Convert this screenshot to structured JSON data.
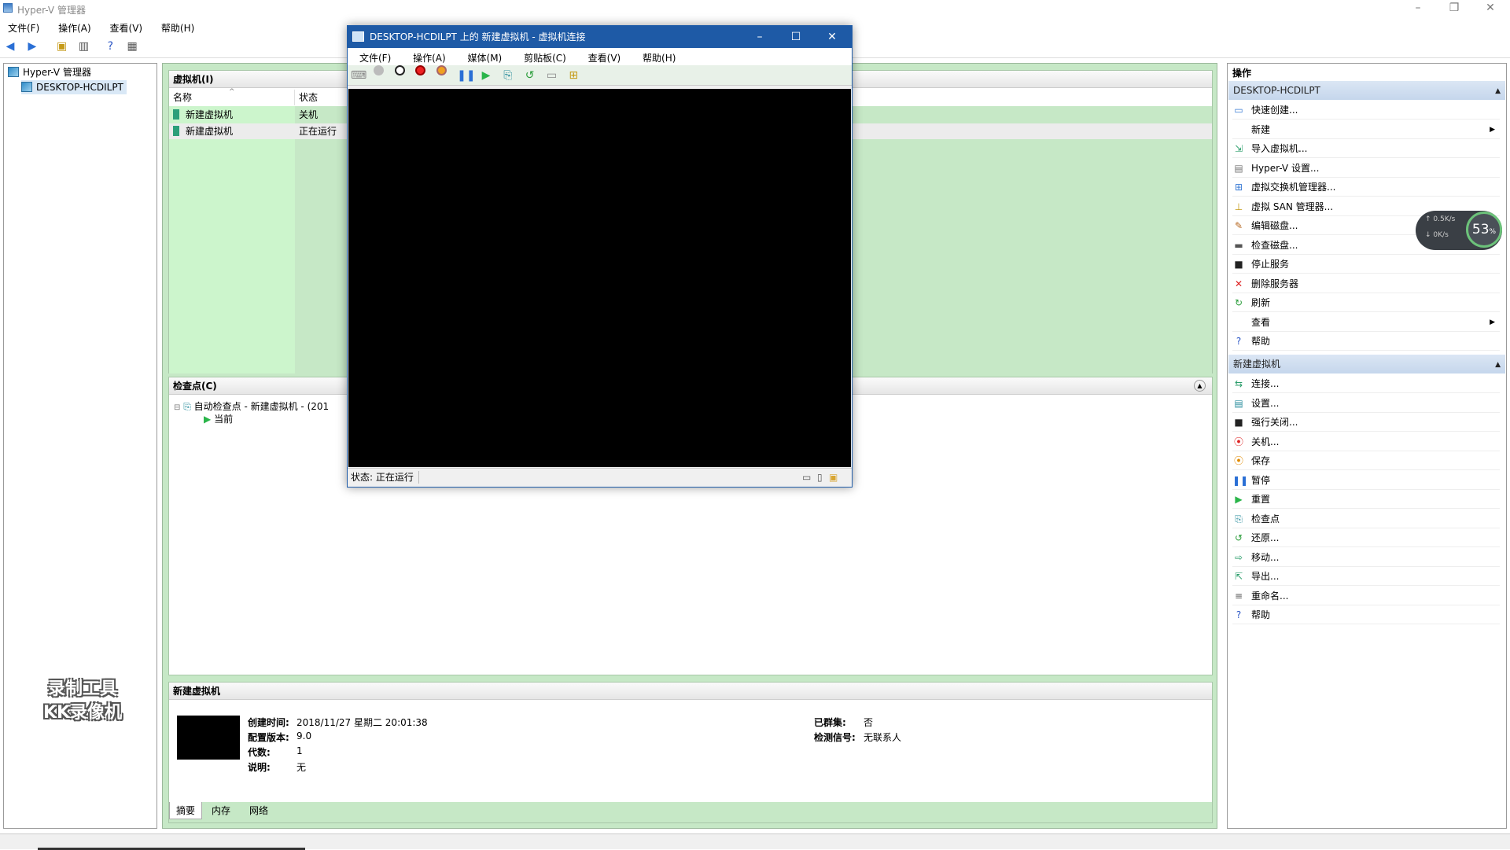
{
  "window": {
    "title": "Hyper-V 管理器",
    "minimize": "–",
    "restore": "❐",
    "close": "✕"
  },
  "menu": [
    "文件(F)",
    "操作(A)",
    "查看(V)",
    "帮助(H)"
  ],
  "tree": {
    "root": "Hyper-V 管理器",
    "server": "DESKTOP-HCDILPT"
  },
  "vm_panel": {
    "title": "虚拟机(I)",
    "col_name": "名称",
    "col_state": "状态",
    "rows": [
      {
        "name": "新建虚拟机",
        "state": "关机"
      },
      {
        "name": "新建虚拟机",
        "state": "正在运行"
      }
    ]
  },
  "checkpoint_panel": {
    "title": "检查点(C)",
    "item": "自动检查点 - 新建虚拟机 - (201",
    "current": "当前"
  },
  "summary_panel": {
    "title": "新建虚拟机",
    "created_label": "创建时间:",
    "created_value": "2018/11/27 星期二 20:01:38",
    "config_label": "配置版本:",
    "config_value": "9.0",
    "gen_label": "代数:",
    "gen_value": "1",
    "desc_label": "说明:",
    "desc_value": "无",
    "cluster_label": "已群集:",
    "cluster_value": "否",
    "heartbeat_label": "检测信号:",
    "heartbeat_value": "无联系人",
    "tabs": [
      "摘要",
      "内存",
      "网络"
    ]
  },
  "actions": {
    "title": "操作",
    "server_section": "DESKTOP-HCDILPT",
    "server_items": [
      {
        "label": "快速创建...",
        "icon": "quick-create-icon",
        "glyph": "▭",
        "color": "#3a7bd5"
      },
      {
        "label": "新建",
        "icon": "",
        "glyph": "",
        "color": "#000",
        "submenu": true
      },
      {
        "label": "导入虚拟机...",
        "icon": "import-icon",
        "glyph": "⇲",
        "color": "#2a9d6a"
      },
      {
        "label": "Hyper-V 设置...",
        "icon": "settings-icon",
        "glyph": "▤",
        "color": "#777"
      },
      {
        "label": "虚拟交换机管理器...",
        "icon": "switch-icon",
        "glyph": "⊞",
        "color": "#3a7bd5"
      },
      {
        "label": "虚拟 SAN 管理器...",
        "icon": "san-icon",
        "glyph": "⊥",
        "color": "#c59a17"
      },
      {
        "label": "编辑磁盘...",
        "icon": "edit-disk-icon",
        "glyph": "✎",
        "color": "#b5651d"
      },
      {
        "label": "检查磁盘...",
        "icon": "inspect-disk-icon",
        "glyph": "▬",
        "color": "#555"
      },
      {
        "label": "停止服务",
        "icon": "stop-icon",
        "glyph": "■",
        "color": "#222"
      },
      {
        "label": "删除服务器",
        "icon": "delete-icon",
        "glyph": "✕",
        "color": "#d22"
      },
      {
        "label": "刷新",
        "icon": "refresh-icon",
        "glyph": "↻",
        "color": "#2a9d3a"
      },
      {
        "label": "查看",
        "icon": "",
        "glyph": "",
        "color": "#000",
        "submenu": true
      },
      {
        "label": "帮助",
        "icon": "help-icon",
        "glyph": "?",
        "color": "#2a55c5"
      }
    ],
    "vm_section": "新建虚拟机",
    "vm_items": [
      {
        "label": "连接...",
        "icon": "connect-icon",
        "glyph": "⇆",
        "color": "#2a9d6a"
      },
      {
        "label": "设置...",
        "icon": "vm-settings-icon",
        "glyph": "▤",
        "color": "#2a8d9d"
      },
      {
        "label": "强行关闭...",
        "icon": "turn-off-icon",
        "glyph": "■",
        "color": "#222"
      },
      {
        "label": "关机...",
        "icon": "shutdown-icon",
        "glyph": "⦿",
        "color": "#d22"
      },
      {
        "label": "保存",
        "icon": "save-icon",
        "glyph": "⦿",
        "color": "#e08a00"
      },
      {
        "label": "暂停",
        "icon": "pause-icon",
        "glyph": "❚❚",
        "color": "#2a6fd5"
      },
      {
        "label": "重置",
        "icon": "reset-icon",
        "glyph": "▶",
        "color": "#2ab54a"
      },
      {
        "label": "检查点",
        "icon": "checkpoint-icon",
        "glyph": "⎘",
        "color": "#2a8d9d"
      },
      {
        "label": "还原...",
        "icon": "revert-icon",
        "glyph": "↺",
        "color": "#2a9d3a"
      },
      {
        "label": "移动...",
        "icon": "move-icon",
        "glyph": "⇨",
        "color": "#2a9d6a"
      },
      {
        "label": "导出...",
        "icon": "export-icon",
        "glyph": "⇱",
        "color": "#2a9d6a"
      },
      {
        "label": "重命名...",
        "icon": "rename-icon",
        "glyph": "≡",
        "color": "#555"
      },
      {
        "label": "帮助",
        "icon": "help-icon",
        "glyph": "?",
        "color": "#2a55c5"
      }
    ]
  },
  "vm_window": {
    "title": "DESKTOP-HCDILPT 上的 新建虚拟机 - 虚拟机连接",
    "menu": [
      "文件(F)",
      "操作(A)",
      "媒体(M)",
      "剪贴板(C)",
      "查看(V)",
      "帮助(H)"
    ],
    "status": "状态: 正在运行"
  },
  "net_gauge": {
    "up": "0.5K/s",
    "down": "0K/s",
    "percent": "53",
    "percent_suffix": "%"
  },
  "watermark": {
    "line1": "录制工具",
    "line2": "KK录像机"
  }
}
